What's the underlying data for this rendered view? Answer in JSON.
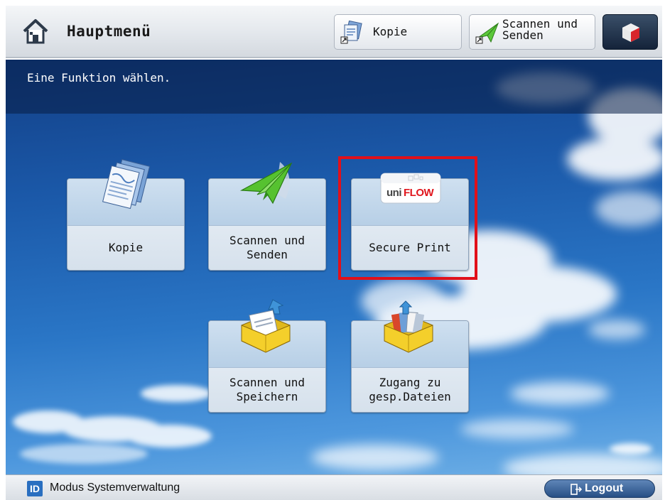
{
  "header": {
    "title": "Hauptmenü",
    "shortcuts": [
      {
        "label": "Kopie",
        "icon": "copy-shortcut-icon"
      },
      {
        "label": "Scannen und\nSenden",
        "icon": "scan-send-shortcut-icon"
      }
    ],
    "settings_icon": "settings-cube-icon"
  },
  "instruction": "Eine Funktion wählen.",
  "tiles": [
    {
      "label": "Kopie",
      "icon": "copy-documents-icon"
    },
    {
      "label": "Scannen und\nSenden",
      "icon": "paper-plane-icon"
    },
    {
      "label": "Secure Print",
      "icon": "uniflow-logo"
    },
    {
      "label": "Scannen und\nSpeichern",
      "icon": "folder-save-icon"
    },
    {
      "label": "Zugang zu\ngesp.Dateien",
      "icon": "folder-access-icon"
    }
  ],
  "highlighted_tile": "Secure Print",
  "footer": {
    "mode_text": "Modus Systemverwaltung",
    "id_badge": "ID",
    "logout_label": "Logout"
  },
  "colors": {
    "highlight": "#e1101a",
    "sky_top": "#123f86",
    "sky_bottom": "#6fb0e6"
  }
}
